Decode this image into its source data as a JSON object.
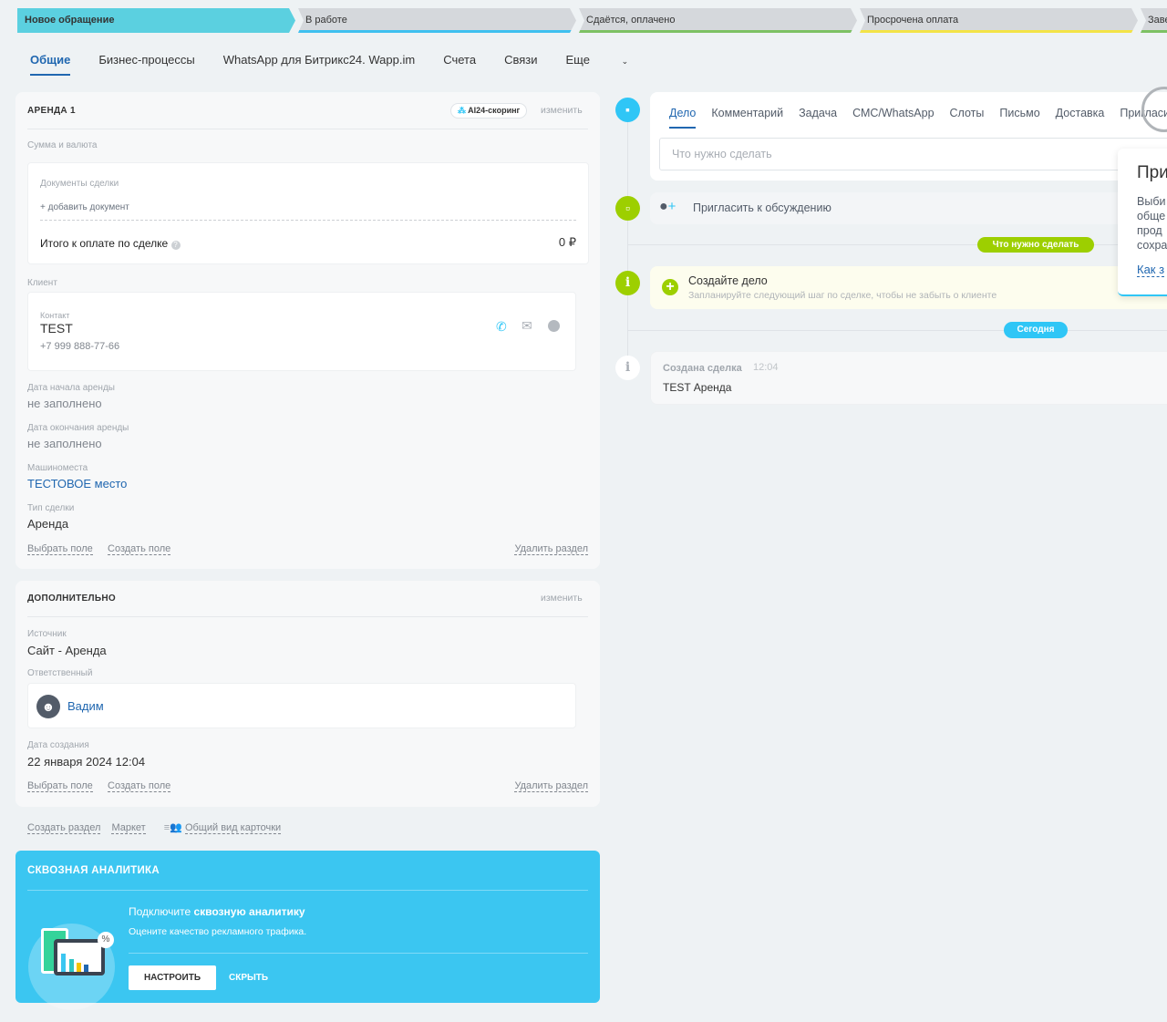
{
  "stages": [
    {
      "label": "Новое обращение",
      "color": "#5bd0e0"
    },
    {
      "label": "В работе",
      "color": "#3ec0ef"
    },
    {
      "label": "Сдаётся, оплачено",
      "color": "#7dc163"
    },
    {
      "label": "Просрочена оплата",
      "color": "#f3e346"
    },
    {
      "label": "Заве",
      "color": "#7dc163"
    }
  ],
  "tabs": [
    "Общие",
    "Бизнес-процессы",
    "WhatsApp для Битрикс24. Wapp.im",
    "Счета",
    "Связи",
    "Еще"
  ],
  "section1": {
    "title": "АРЕНДА 1",
    "scoring": "AI24-скоринг",
    "edit": "изменить",
    "sum_label": "Сумма и валюта",
    "docs_label": "Документы сделки",
    "add_doc": "+ добавить документ",
    "total_label": "Итого к оплате по сделке",
    "total_value": "0 ₽",
    "client_label": "Клиент",
    "contact_label": "Контакт",
    "contact_name": "TEST",
    "contact_phone": "+7 999 888-77-66",
    "fields": [
      {
        "label": "Дата начала аренды",
        "value": "не заполнено",
        "kind": "empty"
      },
      {
        "label": "Дата окончания аренды",
        "value": "не заполнено",
        "kind": "empty"
      },
      {
        "label": "Машиноместа",
        "value": "ТЕСТОВОЕ место",
        "kind": "link"
      },
      {
        "label": "Тип сделки",
        "value": "Аренда",
        "kind": "normal"
      }
    ],
    "select_field": "Выбрать поле",
    "create_field": "Создать поле",
    "delete_section": "Удалить раздел"
  },
  "section2": {
    "title": "ДОПОЛНИТЕЛЬНО",
    "edit": "изменить",
    "source_label": "Источник",
    "source_value": "Сайт - Аренда",
    "resp_label": "Ответственный",
    "resp_name": "Вадим",
    "created_label": "Дата создания",
    "created_value": "22 января 2024 12:04",
    "select_field": "Выбрать поле",
    "create_field": "Создать поле",
    "delete_section": "Удалить раздел"
  },
  "bottom_links": {
    "create_section": "Создать раздел",
    "market": "Маркет",
    "card_view": "Общий вид карточки"
  },
  "analytics": {
    "title": "СКВОЗНАЯ АНАЛИТИКА",
    "line1_pre": "Подключите ",
    "line1_bold": "сквозную аналитику",
    "line2": "Оцените качество рекламного трафика.",
    "setup": "НАСТРОИТЬ",
    "hide": "СКРЫТЬ"
  },
  "timeline": {
    "tabs": [
      "Дело",
      "Комментарий",
      "Задача",
      "СМС/WhatsApp",
      "Слоты",
      "Письмо",
      "Доставка",
      "Приглаcи"
    ],
    "placeholder": "Что нужно сделать",
    "invite": "Пригласить к обсуждению",
    "todo_badge": "Что нужно сделать",
    "create_title": "Создайте дело",
    "create_sub": "Запланируйте следующий шаг по сделке, чтобы не забыть о клиенте",
    "today_badge": "Сегодня",
    "event_title": "Создана сделка",
    "event_time": "12:04",
    "event_text": "TEST Аренда"
  },
  "popup": {
    "title": "При",
    "lines": [
      "Выби",
      "обще",
      "прод",
      "сохра"
    ],
    "link": "Как з"
  }
}
